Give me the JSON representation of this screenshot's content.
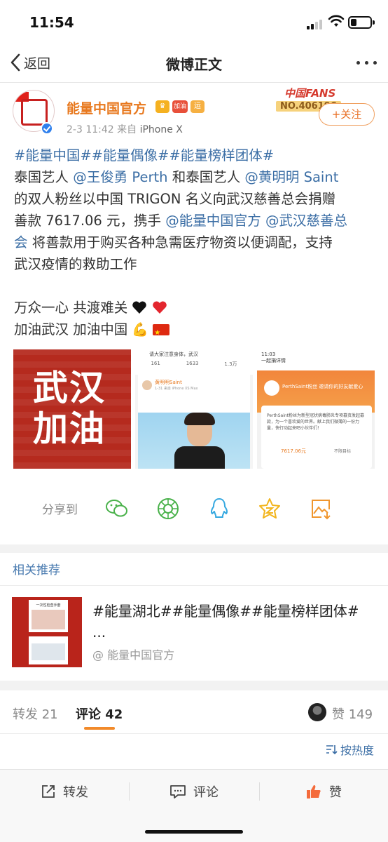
{
  "status_bar": {
    "time": "11:54"
  },
  "nav": {
    "back_label": "返回",
    "title": "微博正文"
  },
  "author": {
    "name": "能量中国官方",
    "meta_date": "2-3 11:42",
    "meta_from": "来自",
    "meta_device": "iPhone X",
    "badge_oil": "加油",
    "badge_yun": "运",
    "fans_label": "中国FANS",
    "fans_no": "NO.406196",
    "follow_label": "+关注"
  },
  "post": {
    "tags": "#能量中国##能量偶像##能量榜样团体#",
    "l2_a": "泰国艺人 ",
    "l2_link1": "@王俊勇 Perth",
    "l2_b": " 和泰国艺人 ",
    "l2_link2": "@黄明明 Saint",
    "l3": "的双人粉丝以中国 TRIGON 名义向武汉慈善总会捐赠",
    "l4_a": "善款 7617.06 元，携手 ",
    "l4_link1": "@能量中国官方",
    "l4_b": " ",
    "l4_link2": "@武汉慈善总",
    "l5_link": "会",
    "l5_b": "  将善款用于购买各种急需医疗物资以便调配，支持",
    "l6": "武汉疫情的救助工作",
    "l7": "万众一心 共渡难关 ",
    "l8": "加油武汉 加油中国 "
  },
  "images": [
    {
      "big_text_1": "武汉",
      "big_text_2": "加油"
    },
    {
      "header": "请大家注意身体，武汉",
      "stats": [
        "161",
        "1633",
        "1.3万"
      ],
      "user": "黄明明Saint",
      "sub": "1-31  来自 iPhone XS Max"
    },
    {
      "time": "11:03",
      "bar_title": "一起捐详情",
      "banner": "PerthSaint粉丝 邀请你的好友献爱心",
      "desc": "PerthSaint粉丝为新型冠状病毒肺炎专项募资发起募款，为一个喜欢爱的世界。献上我们微薄的一份力量，快行动起来吧小伙伴们！",
      "amount": "7617.06元",
      "goal": "不限目标"
    }
  ],
  "share": {
    "label": "分享到",
    "icons": [
      "wechat-icon",
      "moments-icon",
      "qq-icon",
      "qzone-icon",
      "save-image-icon"
    ]
  },
  "related": {
    "title": "相关推荐",
    "item_text": "#能量湖北##能量偶像##能量榜样团体# ...",
    "item_source": "@ 能量中国官方",
    "thumb_header": "一次性检查手套"
  },
  "tabs": {
    "repost_label": "转发",
    "repost_count": "21",
    "comment_label": "评论",
    "comment_count": "42",
    "like_label": "赞",
    "like_count": "149"
  },
  "sort_label": "按热度",
  "bottom_bar": {
    "repost": "转发",
    "comment": "评论",
    "like": "赞"
  },
  "colors": {
    "accent": "#e8791f",
    "link": "#3b6ea5",
    "tab_underline": "#f28a2a"
  }
}
